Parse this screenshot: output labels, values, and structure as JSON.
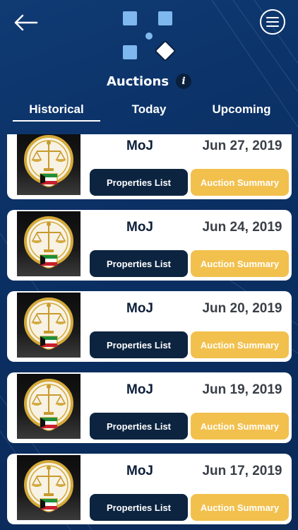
{
  "header": {
    "title": "Auctions",
    "info_label": "i",
    "back_icon": "back-arrow-icon",
    "menu_icon": "hamburger-menu-icon"
  },
  "tabs": [
    {
      "label": "Historical",
      "active": true
    },
    {
      "label": "Today",
      "active": false
    },
    {
      "label": "Upcoming",
      "active": false
    }
  ],
  "auctions": [
    {
      "agency": "MoJ",
      "date": "Jun 27, 2019",
      "properties_label": "Properties List",
      "summary_label": "Auction Summary"
    },
    {
      "agency": "MoJ",
      "date": "Jun 24, 2019",
      "properties_label": "Properties List",
      "summary_label": "Auction Summary"
    },
    {
      "agency": "MoJ",
      "date": "Jun 20, 2019",
      "properties_label": "Properties List",
      "summary_label": "Auction Summary"
    },
    {
      "agency": "MoJ",
      "date": "Jun 19, 2019",
      "properties_label": "Properties List",
      "summary_label": "Auction Summary"
    },
    {
      "agency": "MoJ",
      "date": "Jun 17, 2019",
      "properties_label": "Properties List",
      "summary_label": "Auction Summary"
    }
  ],
  "colors": {
    "background": "#0f3a73",
    "dark_button": "#0c2440",
    "accent_button": "#f2c04d",
    "logo_blue": "#7fb8ee"
  }
}
